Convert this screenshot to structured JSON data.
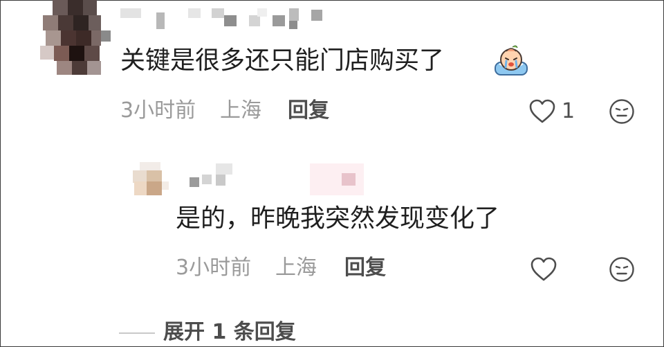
{
  "comment": {
    "text": "关键是很多还只能门店购买了",
    "time": "3小时前",
    "location": "上海",
    "reply_label": "回复",
    "likes": "1",
    "like_icon": "heart-outline-icon",
    "emoji_icon": "crying-face-emoji",
    "dislike_icon": "neutral-face-icon"
  },
  "reply": {
    "text": "是的，昨晚我突然发现变化了",
    "time": "3小时前",
    "location": "上海",
    "reply_label": "回复",
    "like_icon": "heart-outline-icon",
    "dislike_icon": "neutral-face-icon"
  },
  "expand_label": "展开 1 条回复",
  "colors": {
    "text": "#1f1f1f",
    "meta": "#9a9a9a",
    "action": "#4d4d4d",
    "divider": "#c9c9c9"
  }
}
